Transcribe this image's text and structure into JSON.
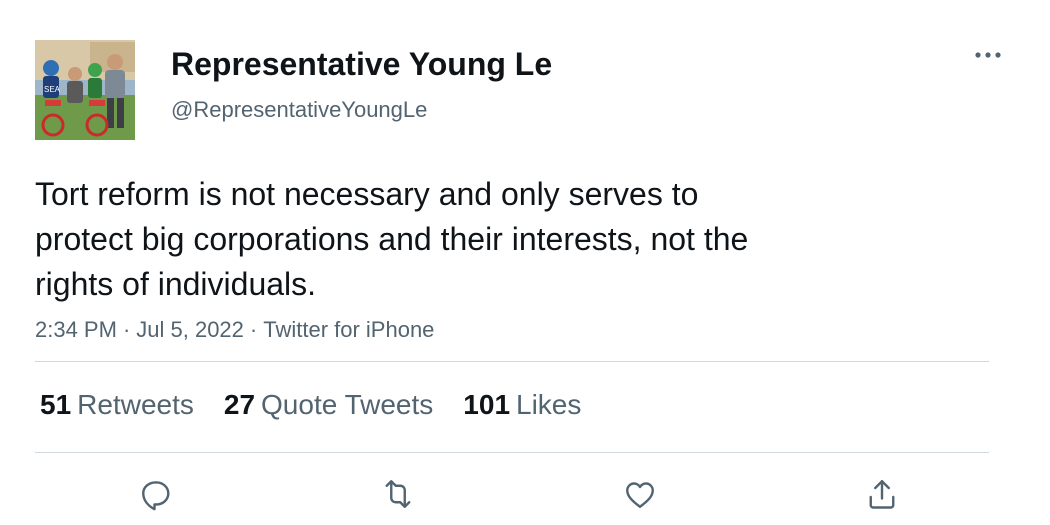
{
  "author": {
    "display_name": "Representative Young Le",
    "handle": "@RepresentativeYoungLe",
    "avatar_icon": "family-photo-avatar"
  },
  "tweet": {
    "text": "Tort reform is not necessary and only serves to\nprotect big corporations and their interests, not the\nrights of individuals.",
    "time": "2:34 PM",
    "date": "Jul 5, 2022",
    "source": "Twitter for iPhone",
    "separator": "·"
  },
  "stats": [
    {
      "count": "51",
      "label": "Retweets"
    },
    {
      "count": "27",
      "label": "Quote Tweets"
    },
    {
      "count": "101",
      "label": "Likes"
    }
  ],
  "actions": [
    "reply-icon",
    "retweet-icon",
    "like-icon",
    "share-icon"
  ],
  "colors": {
    "text_primary": "#0f1419",
    "text_secondary": "#536471",
    "divider": "#cfd9de"
  }
}
